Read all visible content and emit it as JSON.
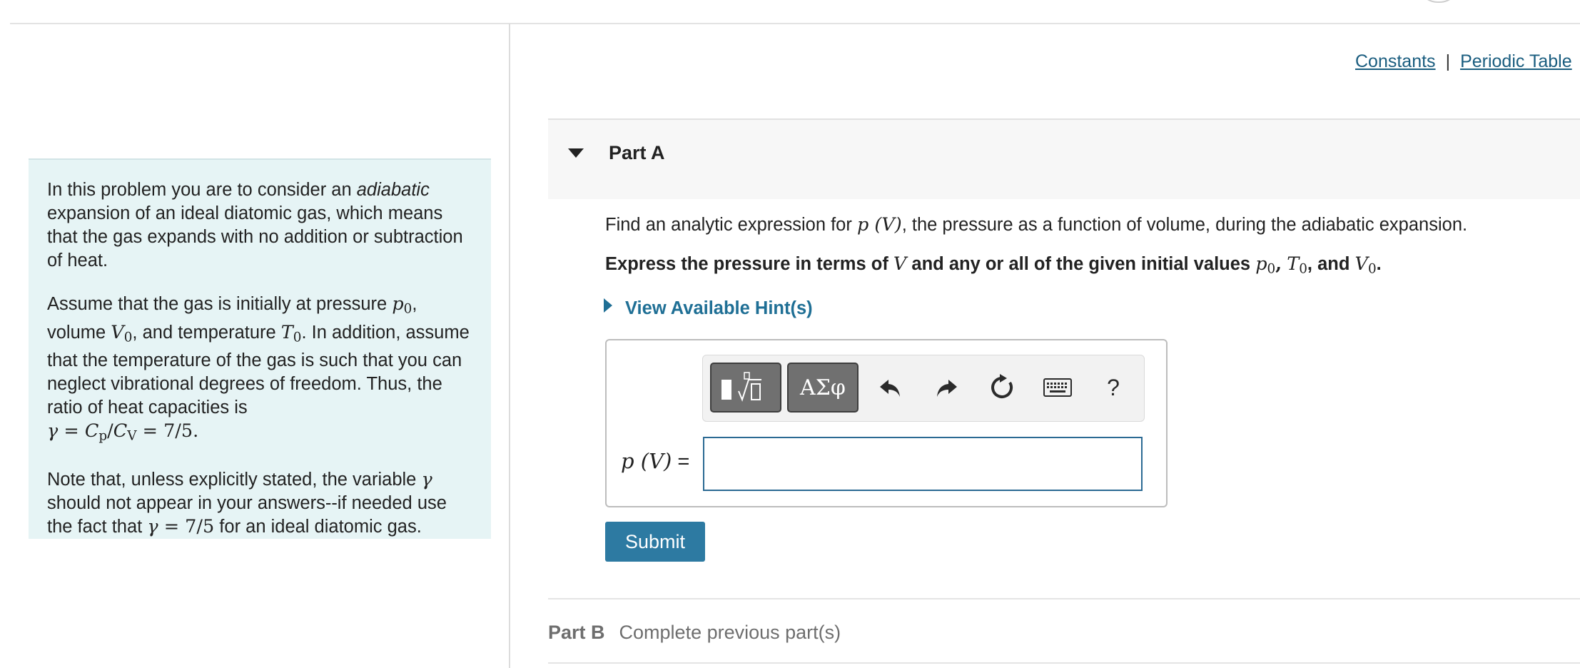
{
  "top_links": {
    "constants": "Constants",
    "separator": "|",
    "periodic_table": "Periodic Table"
  },
  "intro": {
    "p1_a": "In this problem you are to consider an ",
    "p1_em": "adiabatic",
    "p1_b": " expansion of an ideal diatomic gas, which means that the gas expands with no addition or subtraction of heat.",
    "p2_a": "Assume that the gas is initially at pressure ",
    "p2_b": ", volume ",
    "p2_c": ", and temperature ",
    "p2_d": ". In addition, assume that the temperature of the gas is such that you can neglect vibrational degrees of freedom. Thus, the ratio of heat capacities is",
    "p2_formula": "γ = Cp/CV = 7/5.",
    "p3_a": "Note that, unless explicitly stated, the variable ",
    "p3_b": " should not appear in your answers--if needed use the fact that ",
    "p3_formula": "γ = 7/5",
    "p3_c": " for an ideal diatomic gas."
  },
  "math": {
    "p": "p",
    "V": "V",
    "T": "T",
    "zero": "0",
    "gamma": "γ",
    "C": "C",
    "sub_p": "p",
    "sub_V": "V",
    "eq": " = ",
    "slash": "/",
    "seven_fifths": "7/5",
    "period": ".",
    "pV": "p (V)"
  },
  "partA": {
    "title": "Part A",
    "question_a": "Find an analytic expression for ",
    "question_b": ", the pressure as a function of volume, during the adiabatic expansion.",
    "instruction_a": "Express the pressure in terms of ",
    "instruction_b": " and any or all of the given initial values ",
    "comma": ",",
    "and": " and ",
    "dot": ".",
    "hint": "View Available Hint(s)",
    "answer_label": "p (V) =",
    "answer_value": "",
    "toolbar": {
      "templates_icon": "templates-icon",
      "greek_label": "ΑΣφ",
      "undo_icon": "undo-icon",
      "redo_icon": "redo-icon",
      "reset_icon": "reset-icon",
      "keyboard_icon": "keyboard-icon",
      "help_label": "?"
    },
    "submit": "Submit"
  },
  "partB": {
    "title": "Part B",
    "status": "Complete previous part(s)"
  },
  "colors": {
    "info_bg": "#e6f4f5",
    "link": "#1a5d7f",
    "hint": "#1f6f95",
    "submit_bg": "#2d7aa2",
    "input_border": "#2b6a93"
  }
}
